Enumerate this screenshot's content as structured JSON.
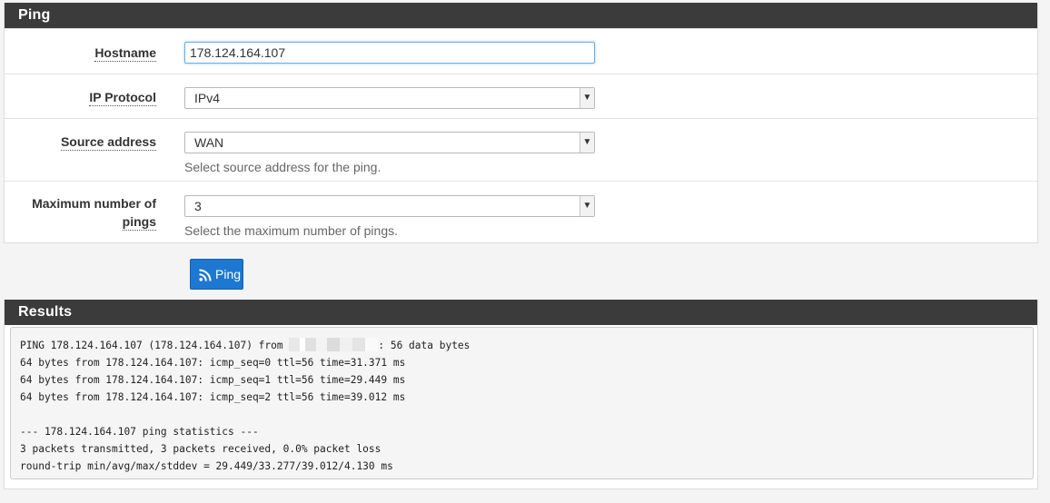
{
  "ping_panel": {
    "title": "Ping",
    "hostname": {
      "label": "Hostname",
      "value": "178.124.164.107"
    },
    "ip_protocol": {
      "label": "IP Protocol",
      "selected": "IPv4"
    },
    "source_address": {
      "label": "Source address",
      "selected": "WAN",
      "help": "Select source address for the ping."
    },
    "max_pings": {
      "label_line1": "Maximum number of",
      "label_line2": "pings",
      "selected": "3",
      "help": "Select the maximum number of pings."
    },
    "ping_button_label": "Ping"
  },
  "results_panel": {
    "title": "Results",
    "line1_prefix": "PING 178.124.164.107 (178.124.164.107) from ",
    "line1_suffix": ": 56 data bytes",
    "lines": [
      "64 bytes from 178.124.164.107: icmp_seq=0 ttl=56 time=31.371 ms",
      "64 bytes from 178.124.164.107: icmp_seq=1 ttl=56 time=29.449 ms",
      "64 bytes from 178.124.164.107: icmp_seq=2 ttl=56 time=39.012 ms",
      "",
      "--- 178.124.164.107 ping statistics ---",
      "3 packets transmitted, 3 packets received, 0.0% packet loss",
      "round-trip min/avg/max/stddev = 29.449/33.277/39.012/4.130 ms"
    ]
  },
  "colors": {
    "heading_bg": "#3b3b3b",
    "button_bg": "#1e78d1",
    "focus_border": "#66afe9"
  }
}
